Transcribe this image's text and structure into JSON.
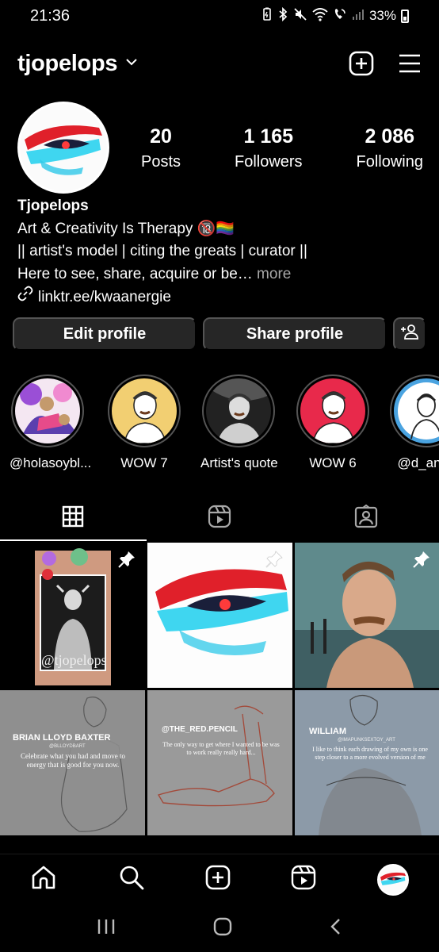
{
  "status_bar": {
    "time": "21:36",
    "battery": "33%",
    "icons": [
      "battery-saver-icon",
      "bluetooth-icon",
      "mute-icon",
      "wifi-icon",
      "wifi-calling-icon",
      "signal-icon"
    ]
  },
  "header": {
    "username": "tjopelops",
    "icons": [
      "chevron-down-icon",
      "create-post-icon",
      "menu-icon"
    ]
  },
  "stats": [
    {
      "value": "20",
      "label": "Posts"
    },
    {
      "value": "1 165",
      "label": "Followers"
    },
    {
      "value": "2 086",
      "label": "Following"
    }
  ],
  "bio": {
    "name": "Tjopelops",
    "line1": "Art & Creativity Is Therapy 🔞🏳️‍🌈",
    "line2": "|| artist's model | citing the greats | curator ||",
    "line3": "Here to see, share, acquire or be",
    "ellipsis": "…",
    "more": " more",
    "link": "linktr.ee/kwaanergie"
  },
  "buttons": {
    "edit": "Edit profile",
    "share": "Share profile"
  },
  "highlights": [
    {
      "label": "@holasoybl..."
    },
    {
      "label": "WOW 7",
      "bg": "#f2cf72"
    },
    {
      "label": "Artist's quote",
      "bg": "#222222"
    },
    {
      "label": "WOW 6",
      "bg": "#e8294b"
    },
    {
      "label": "@d_any_"
    }
  ],
  "tabs": [
    "grid-icon",
    "reels-icon",
    "tagged-icon"
  ],
  "grid": [
    {
      "caption": "@tjopelops",
      "pinned": true
    },
    {
      "pinned": true
    },
    {
      "pinned": true
    },
    {
      "title": "BRIAN LLOYD BAXTER",
      "handle": "@BLLOYDBART",
      "quote": "Celebrate what you had and move to energy that is good for you now."
    },
    {
      "title": "@THE_RED.PENCIL",
      "quote": "The only way to get where I wanted to be was to work really really hard..."
    },
    {
      "title": "WILLIAM",
      "handle": "@IMAPUNKSEXTOY_ART",
      "quote": "I like to think each drawing of my own is one step closer to a more evolved version of me"
    }
  ],
  "bottom_nav": [
    "home-icon",
    "search-icon",
    "new-post-icon",
    "reels-icon",
    "profile-avatar"
  ],
  "colors": {
    "background": "#000000",
    "button_bg": "#262626",
    "secondary_text": "#a8a8a8",
    "brand_red": "#e0202a",
    "brand_cyan": "#3fd6f0"
  }
}
